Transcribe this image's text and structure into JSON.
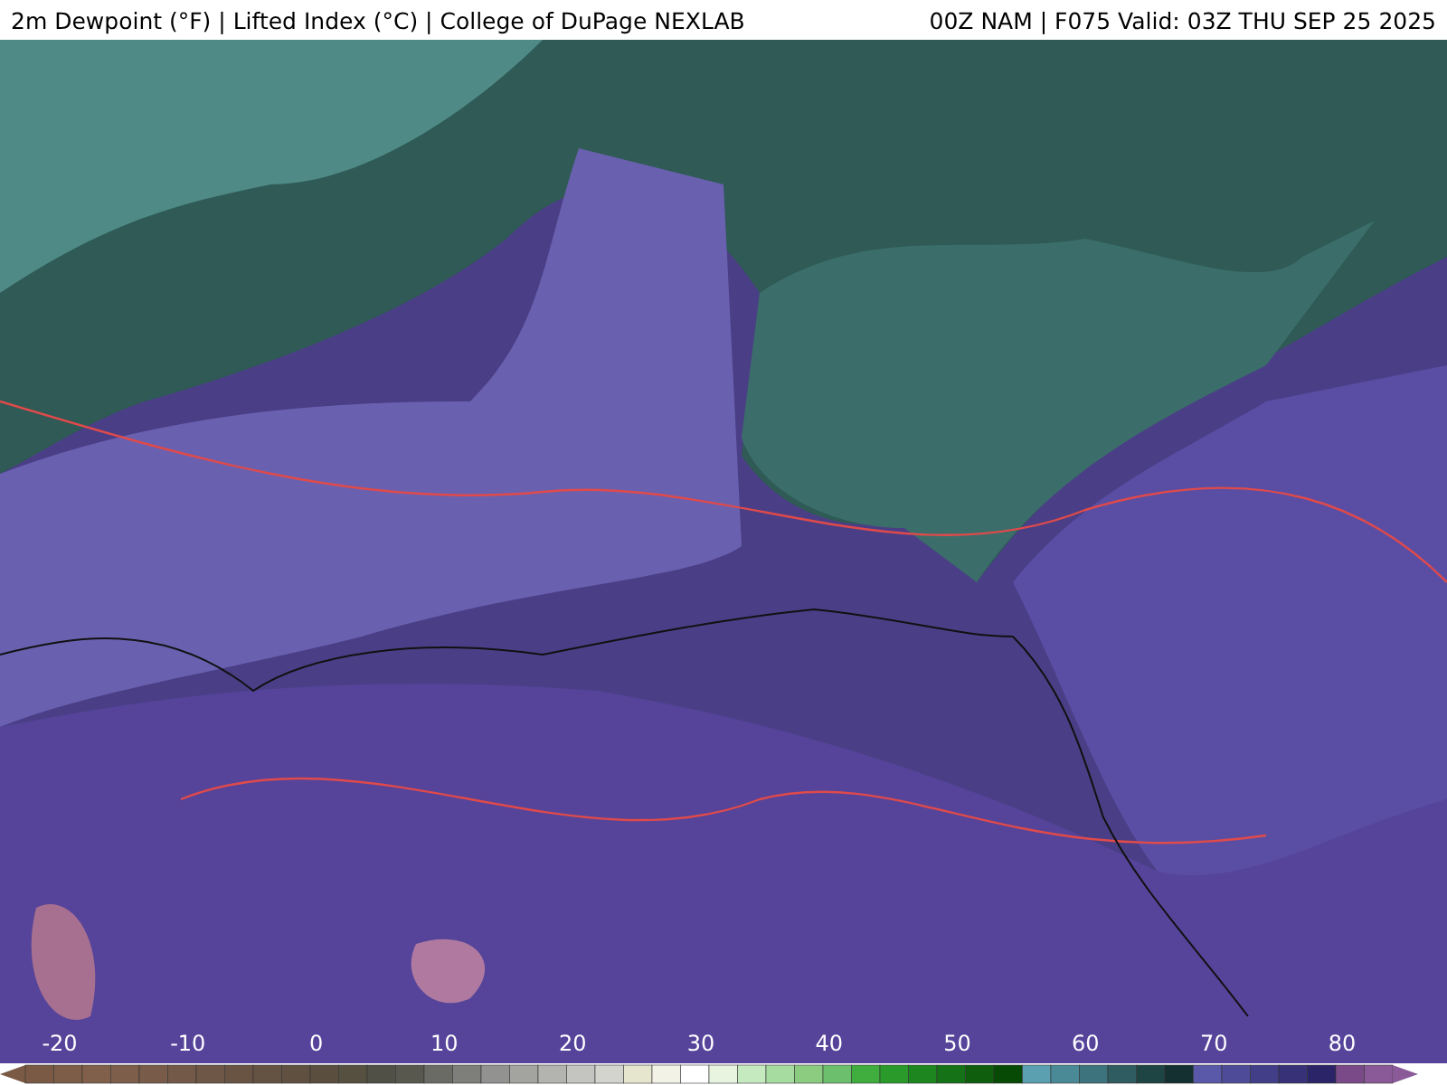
{
  "header": {
    "title": "2m Dewpoint (°F) | Lifted Index (°C) | College of DuPage NEXLAB",
    "run_info": "00Z NAM | F075 Valid: 03Z THU SEP 25 2025"
  },
  "color_scale": {
    "ticks": [
      "-20",
      "-10",
      "0",
      "10",
      "20",
      "30",
      "40",
      "50",
      "60",
      "70",
      "80"
    ]
  }
}
